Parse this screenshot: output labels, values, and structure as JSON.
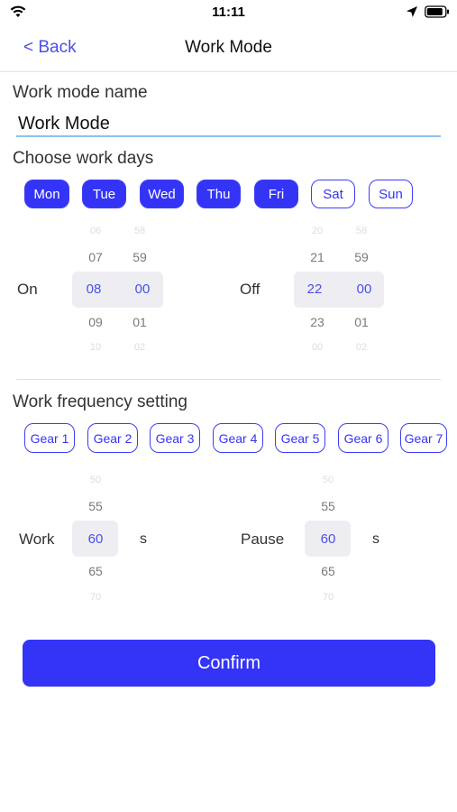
{
  "status_bar": {
    "time": "11:11"
  },
  "nav": {
    "back_label": "< Back",
    "title": "Work Mode"
  },
  "name_section": {
    "label": "Work mode name",
    "value": "Work Mode"
  },
  "days_section": {
    "label": "Choose work days",
    "days": [
      {
        "label": "Mon",
        "selected": true
      },
      {
        "label": "Tue",
        "selected": true
      },
      {
        "label": "Wed",
        "selected": true
      },
      {
        "label": "Thu",
        "selected": true
      },
      {
        "label": "Fri",
        "selected": true
      },
      {
        "label": "Sat",
        "selected": false
      },
      {
        "label": "Sun",
        "selected": false
      }
    ]
  },
  "time_pickers": {
    "on": {
      "label": "On",
      "hours": [
        "06",
        "07",
        "08",
        "09",
        "10"
      ],
      "minutes": [
        "58",
        "59",
        "00",
        "01",
        "02"
      ]
    },
    "off": {
      "label": "Off",
      "hours": [
        "20",
        "21",
        "22",
        "23",
        "00"
      ],
      "minutes": [
        "58",
        "59",
        "00",
        "01",
        "02"
      ]
    }
  },
  "frequency_section": {
    "label": "Work frequency setting",
    "gears": [
      "Gear 1",
      "Gear 2",
      "Gear 3",
      "Gear 4",
      "Gear 5",
      "Gear 6",
      "Gear 7"
    ]
  },
  "frequency_pickers": {
    "work": {
      "label": "Work",
      "values": [
        "50",
        "55",
        "60",
        "65",
        "70"
      ],
      "unit": "s"
    },
    "pause": {
      "label": "Pause",
      "values": [
        "50",
        "55",
        "60",
        "65",
        "70"
      ],
      "unit": "s"
    }
  },
  "confirm_label": "Confirm",
  "colors": {
    "accent": "#3434f7",
    "link": "#4a4fe8",
    "input_underline": "#8cc0ef"
  }
}
